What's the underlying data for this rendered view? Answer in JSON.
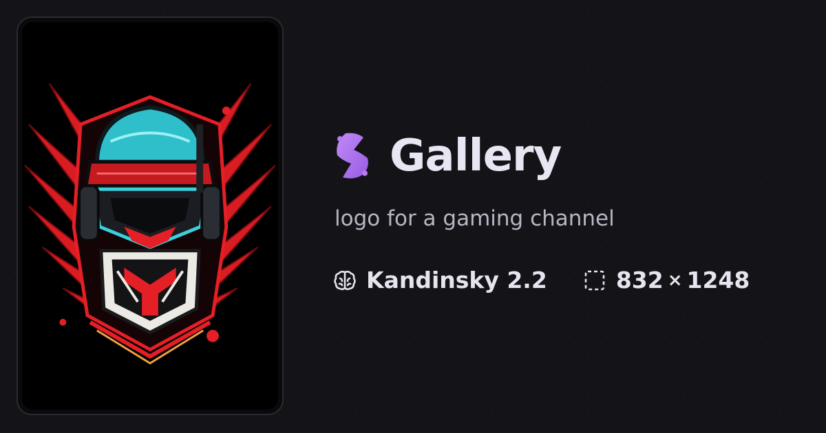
{
  "card": {
    "image_alt": "gaming channel logo artwork",
    "accent_colors": {
      "red": "#e51f26",
      "cyan": "#3ad1dd",
      "dark": "#14161a"
    }
  },
  "brand": {
    "title": "Gallery",
    "icon": "gallery-logo-icon",
    "icon_color": "#b57cf0"
  },
  "prompt": "logo for a gaming channel",
  "meta": {
    "model_icon": "brain-icon",
    "model": "Kandinsky 2.2",
    "dims_icon": "dashed-frame-icon",
    "width": "832",
    "times": "×",
    "height": "1248"
  }
}
